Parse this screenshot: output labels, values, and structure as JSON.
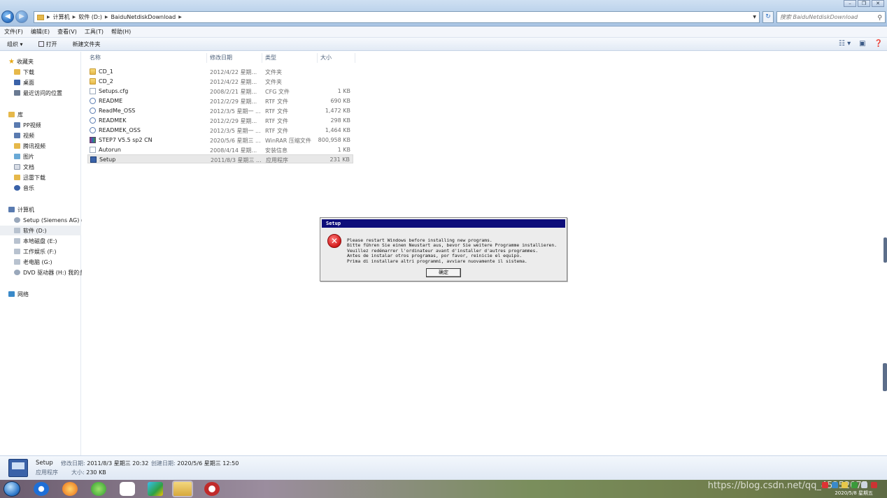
{
  "address": {
    "crumbs": [
      "计算机",
      "软件 (D:)",
      "BaiduNetdiskDownload"
    ],
    "search_placeholder": "搜索 BaiduNetdiskDownload"
  },
  "menubar": [
    "文件(F)",
    "编辑(E)",
    "查看(V)",
    "工具(T)",
    "帮助(H)"
  ],
  "toolbar": {
    "organize": "组织 ▾",
    "open": "打开",
    "new_folder": "新建文件夹"
  },
  "sidebar": {
    "favorites": {
      "label": "收藏夹",
      "items": [
        "下载",
        "桌面",
        "最近访问的位置"
      ]
    },
    "libraries": {
      "label": "库",
      "items": [
        "PP视频",
        "视频",
        "腾讯视频",
        "图片",
        "文档",
        "迅雷下载",
        "音乐"
      ]
    },
    "computer": {
      "label": "计算机",
      "items": [
        "Setup (Siemens AG) (",
        "软件 (D:)",
        "本地磁盘 (E:)",
        "工作娱乐 (F:)",
        "老电脑 (G:)",
        "DVD 驱动器 (H:) 我的多"
      ]
    },
    "network": {
      "label": "网络"
    }
  },
  "columns": {
    "name": "名称",
    "date": "修改日期",
    "type": "类型",
    "size": "大小"
  },
  "files": [
    {
      "name": "CD_1",
      "date": "2012/4/22 星期...",
      "type": "文件夹",
      "size": "",
      "icon": "folder"
    },
    {
      "name": "CD_2",
      "date": "2012/4/22 星期...",
      "type": "文件夹",
      "size": "",
      "icon": "folder"
    },
    {
      "name": "Setups.cfg",
      "date": "2008/2/21 星期...",
      "type": "CFG 文件",
      "size": "1 KB",
      "icon": "doc"
    },
    {
      "name": "README",
      "date": "2012/2/29 星期...",
      "type": "RTF 文件",
      "size": "690 KB",
      "icon": "rtf"
    },
    {
      "name": "ReadMe_OSS",
      "date": "2012/3/5 星期一 ...",
      "type": "RTF 文件",
      "size": "1,472 KB",
      "icon": "rtf"
    },
    {
      "name": "READMEK",
      "date": "2012/2/29 星期...",
      "type": "RTF 文件",
      "size": "298 KB",
      "icon": "rtf"
    },
    {
      "name": "READMEK_OSS",
      "date": "2012/3/5 星期一 ...",
      "type": "RTF 文件",
      "size": "1,464 KB",
      "icon": "rtf"
    },
    {
      "name": "STEP7 V5.5 sp2 CN",
      "date": "2020/5/6 星期三 ...",
      "type": "WinRAR 压缩文件",
      "size": "800,958 KB",
      "icon": "rar"
    },
    {
      "name": "Autorun",
      "date": "2008/4/14 星期...",
      "type": "安装信息",
      "size": "1 KB",
      "icon": "doc"
    },
    {
      "name": "Setup",
      "date": "2011/8/3 星期三 ...",
      "type": "应用程序",
      "size": "231 KB",
      "icon": "app"
    }
  ],
  "dialog": {
    "title": "Setup",
    "lines": [
      "Please restart Windows before installing new programs.",
      "Bitte führen Sie einen Neustart aus, bevor Sie weitere Programme installieren.",
      "Veuillez redémarrer l'ordinateur avant d'installer d'autres programmes.",
      "Antes de instalar otros programas, por favor, reinicie el equipo.",
      "Prima di installare altri programmi, avviare nuovamente il sistema."
    ],
    "ok": "确定"
  },
  "details": {
    "name": "Setup",
    "type": "应用程序",
    "modified_label": "修改日期:",
    "modified": "2011/8/3 星期三 20:32",
    "created_label": "创建日期:",
    "created": "2020/5/6 星期三 12:50",
    "size_label": "大小:",
    "size": "230 KB"
  },
  "taskbar": {
    "clock_date": "2020/5/8 星期五",
    "watermark": "https://blog.csdn.net/qq_45252077"
  },
  "colors": {
    "dialog_title": "#0d0d7a",
    "accent": "#2a6fc2"
  }
}
